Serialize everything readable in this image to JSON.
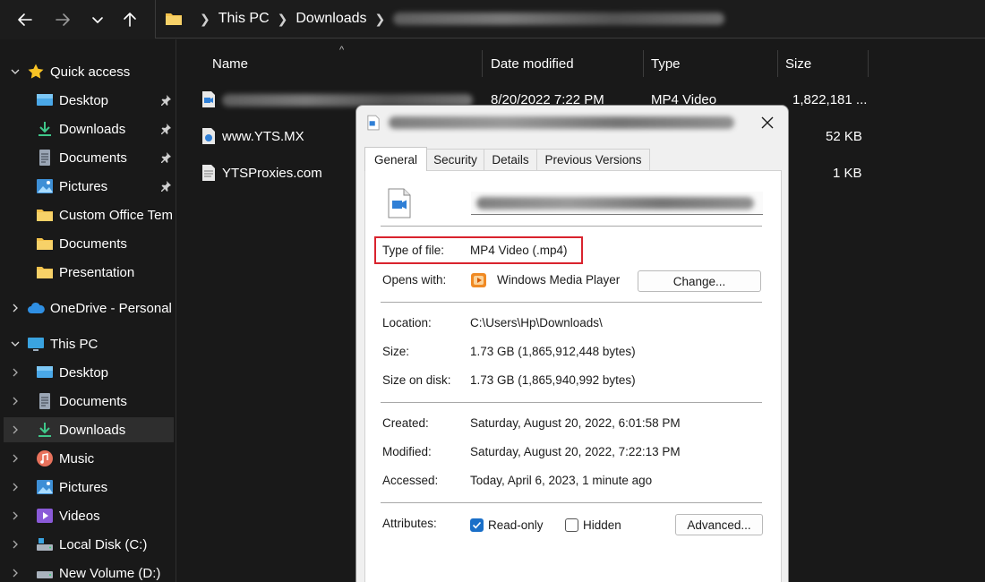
{
  "window": {
    "breadcrumbs": [
      "This PC",
      "Downloads"
    ]
  },
  "sidebar": {
    "quick_access": {
      "label": "Quick access",
      "items": [
        {
          "label": "Desktop",
          "pinned": true
        },
        {
          "label": "Downloads",
          "pinned": true
        },
        {
          "label": "Documents",
          "pinned": true
        },
        {
          "label": "Pictures",
          "pinned": true
        },
        {
          "label": "Custom Office Templates"
        },
        {
          "label": "Documents"
        },
        {
          "label": "Presentation"
        }
      ]
    },
    "onedrive": {
      "label": "OneDrive - Personal"
    },
    "this_pc": {
      "label": "This PC",
      "items": [
        {
          "label": "Desktop"
        },
        {
          "label": "Documents"
        },
        {
          "label": "Downloads",
          "selected": true
        },
        {
          "label": "Music"
        },
        {
          "label": "Pictures"
        },
        {
          "label": "Videos"
        },
        {
          "label": "Local Disk (C:)"
        },
        {
          "label": "New Volume (D:)"
        }
      ]
    }
  },
  "file_list": {
    "columns": [
      "Name",
      "Date modified",
      "Type",
      "Size"
    ],
    "rows": [
      {
        "name": "",
        "date": "8/20/2022 7:22 PM",
        "type": "MP4 Video",
        "size": "1,822,181 ..."
      },
      {
        "name": "www.YTS.MX",
        "date": "",
        "type": "",
        "size": "52 KB"
      },
      {
        "name": "YTSProxies.com",
        "date": "",
        "type": "",
        "size": "1 KB"
      }
    ]
  },
  "dialog": {
    "tabs": [
      "General",
      "Security",
      "Details",
      "Previous Versions"
    ],
    "active_tab": "General",
    "type_of_file": {
      "label": "Type of file:",
      "value": "MP4 Video (.mp4)"
    },
    "opens_with": {
      "label": "Opens with:",
      "value": "Windows Media Player",
      "button": "Change..."
    },
    "location": {
      "label": "Location:",
      "value": "C:\\Users\\Hp\\Downloads\\"
    },
    "size": {
      "label": "Size:",
      "value": "1.73 GB (1,865,912,448 bytes)"
    },
    "size_on_disk": {
      "label": "Size on disk:",
      "value": "1.73 GB (1,865,940,992 bytes)"
    },
    "created": {
      "label": "Created:",
      "value": "Saturday, August 20, 2022, 6:01:58 PM"
    },
    "modified": {
      "label": "Modified:",
      "value": "Saturday, August 20, 2022, 7:22:13 PM"
    },
    "accessed": {
      "label": "Accessed:",
      "value": "Today, April 6, 2023, 1 minute ago"
    },
    "attributes": {
      "label": "Attributes:",
      "read_only": {
        "label": "Read-only",
        "checked": true
      },
      "hidden": {
        "label": "Hidden",
        "checked": false
      },
      "advanced_button": "Advanced..."
    }
  },
  "colors": {
    "explorer_bg": "#191919",
    "dialog_bg": "#f0f0f0",
    "highlight_box": "#d9232e",
    "checkbox_accent": "#1a6fc8",
    "folder_yellow": "#f3c14b",
    "star_yellow": "#f7c325"
  }
}
